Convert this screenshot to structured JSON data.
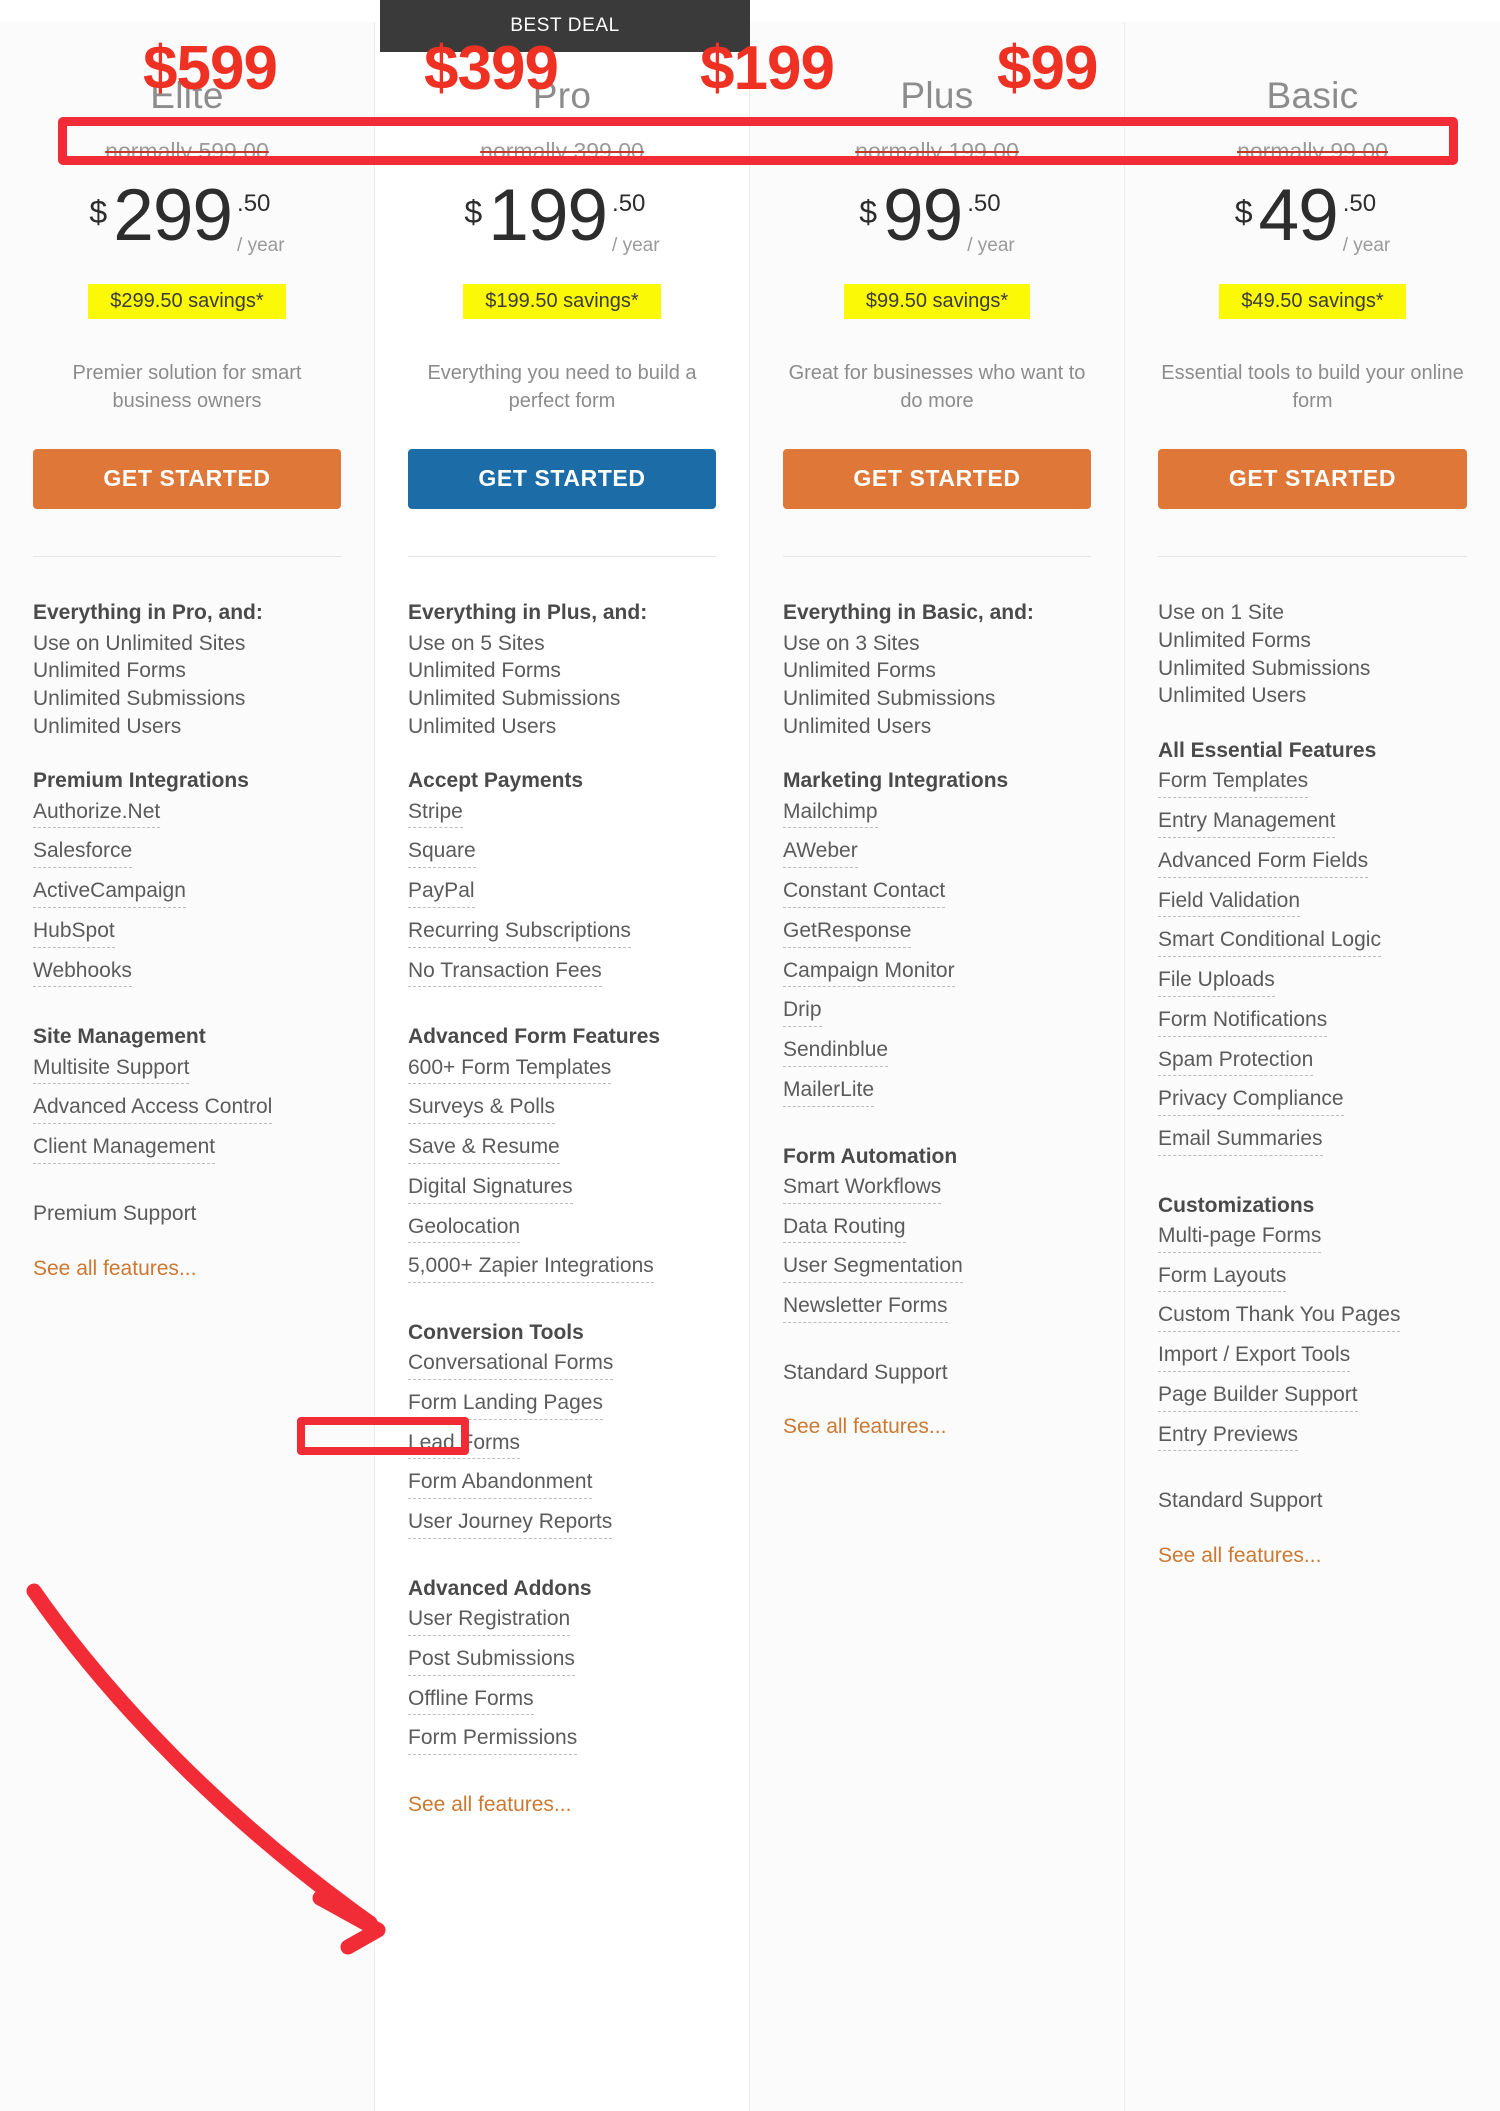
{
  "badge": {
    "best_deal_label": "BEST DEAL"
  },
  "annotations": {
    "highlight_color": "#f22c36",
    "big_prices": [
      "$599",
      "$399",
      "$199",
      "$99"
    ],
    "boxed_row_label": "normally-price-row",
    "arrow_target_label": "User Registration"
  },
  "currency_symbol": "$",
  "see_all_label": "See all features...",
  "plans": [
    {
      "name": "Elite",
      "normally": "normally 599.00",
      "amount": "299",
      "cents": ".50",
      "per": "/ year",
      "savings": "$299.50 savings*",
      "tagline": "Premier solution for smart business owners",
      "cta_label": "GET STARTED",
      "cta_color": "#df7739",
      "featured": false,
      "groups": [
        {
          "heading": "Everything in Pro, and:",
          "plain": [
            "Use on Unlimited Sites",
            "Unlimited Forms",
            "Unlimited Submissions",
            "Unlimited Users"
          ],
          "links": []
        },
        {
          "heading": "Premium Integrations",
          "plain": [],
          "links": [
            "Authorize.Net",
            "Salesforce",
            "ActiveCampaign",
            "HubSpot",
            "Webhooks"
          ]
        },
        {
          "heading": "Site Management",
          "plain": [],
          "links": [
            "Multisite Support",
            "Advanced Access Control",
            "Client Management"
          ]
        },
        {
          "heading": "",
          "plain": [
            "Premium Support"
          ],
          "links": []
        }
      ]
    },
    {
      "name": "Pro",
      "normally": "normally 399.00",
      "amount": "199",
      "cents": ".50",
      "per": "/ year",
      "savings": "$199.50 savings*",
      "tagline": "Everything you need to build a perfect form",
      "cta_label": "GET STARTED",
      "cta_color": "#1c6ca8",
      "featured": true,
      "groups": [
        {
          "heading": "Everything in Plus, and:",
          "plain": [
            "Use on 5 Sites",
            "Unlimited Forms",
            "Unlimited Submissions",
            "Unlimited Users"
          ],
          "links": []
        },
        {
          "heading": "Accept Payments",
          "plain": [],
          "links": [
            "Stripe",
            "Square",
            "PayPal",
            "Recurring Subscriptions",
            "No Transaction Fees"
          ]
        },
        {
          "heading": "Advanced Form Features",
          "plain": [],
          "links": [
            "600+ Form Templates",
            "Surveys & Polls",
            "Save & Resume",
            "Digital Signatures",
            "Geolocation",
            "5,000+ Zapier Integrations"
          ]
        },
        {
          "heading": "Conversion Tools",
          "plain": [],
          "links": [
            "Conversational Forms",
            "Form Landing Pages",
            "Lead Forms",
            "Form Abandonment",
            "User Journey Reports"
          ]
        },
        {
          "heading": "Advanced Addons",
          "plain": [],
          "links": [
            "User Registration",
            "Post Submissions",
            "Offline Forms",
            "Form Permissions"
          ]
        }
      ]
    },
    {
      "name": "Plus",
      "normally": "normally 199.00",
      "amount": "99",
      "cents": ".50",
      "per": "/ year",
      "savings": "$99.50 savings*",
      "tagline": "Great for businesses who want to do more",
      "cta_label": "GET STARTED",
      "cta_color": "#df7739",
      "featured": false,
      "groups": [
        {
          "heading": "Everything in Basic, and:",
          "plain": [
            "Use on 3 Sites",
            "Unlimited Forms",
            "Unlimited Submissions",
            "Unlimited Users"
          ],
          "links": []
        },
        {
          "heading": "Marketing Integrations",
          "plain": [],
          "links": [
            "Mailchimp",
            "AWeber",
            "Constant Contact",
            "GetResponse",
            "Campaign Monitor",
            "Drip",
            "Sendinblue",
            "MailerLite"
          ]
        },
        {
          "heading": "Form Automation",
          "plain": [],
          "links": [
            "Smart Workflows",
            "Data Routing",
            "User Segmentation",
            "Newsletter Forms"
          ]
        },
        {
          "heading": "",
          "plain": [
            "Standard Support"
          ],
          "links": []
        }
      ]
    },
    {
      "name": "Basic",
      "normally": "normally 99.00",
      "amount": "49",
      "cents": ".50",
      "per": "/ year",
      "savings": "$49.50 savings*",
      "tagline": "Essential tools to build your online form",
      "cta_label": "GET STARTED",
      "cta_color": "#df7739",
      "featured": false,
      "groups": [
        {
          "heading": "",
          "plain": [
            "Use on 1 Site",
            "Unlimited Forms",
            "Unlimited Submissions",
            "Unlimited Users"
          ],
          "links": []
        },
        {
          "heading": "All Essential Features",
          "plain": [],
          "links": [
            "Form Templates",
            "Entry Management",
            "Advanced Form Fields",
            "Field Validation",
            "Smart Conditional Logic",
            "File Uploads",
            "Form Notifications",
            "Spam Protection",
            "Privacy Compliance",
            "Email Summaries"
          ]
        },
        {
          "heading": "Customizations",
          "plain": [],
          "links": [
            "Multi-page Forms",
            "Form Layouts",
            "Custom Thank You Pages",
            "Import / Export Tools",
            "Page Builder Support",
            "Entry Previews"
          ]
        },
        {
          "heading": "",
          "plain": [
            "Standard Support"
          ],
          "links": []
        }
      ]
    }
  ]
}
